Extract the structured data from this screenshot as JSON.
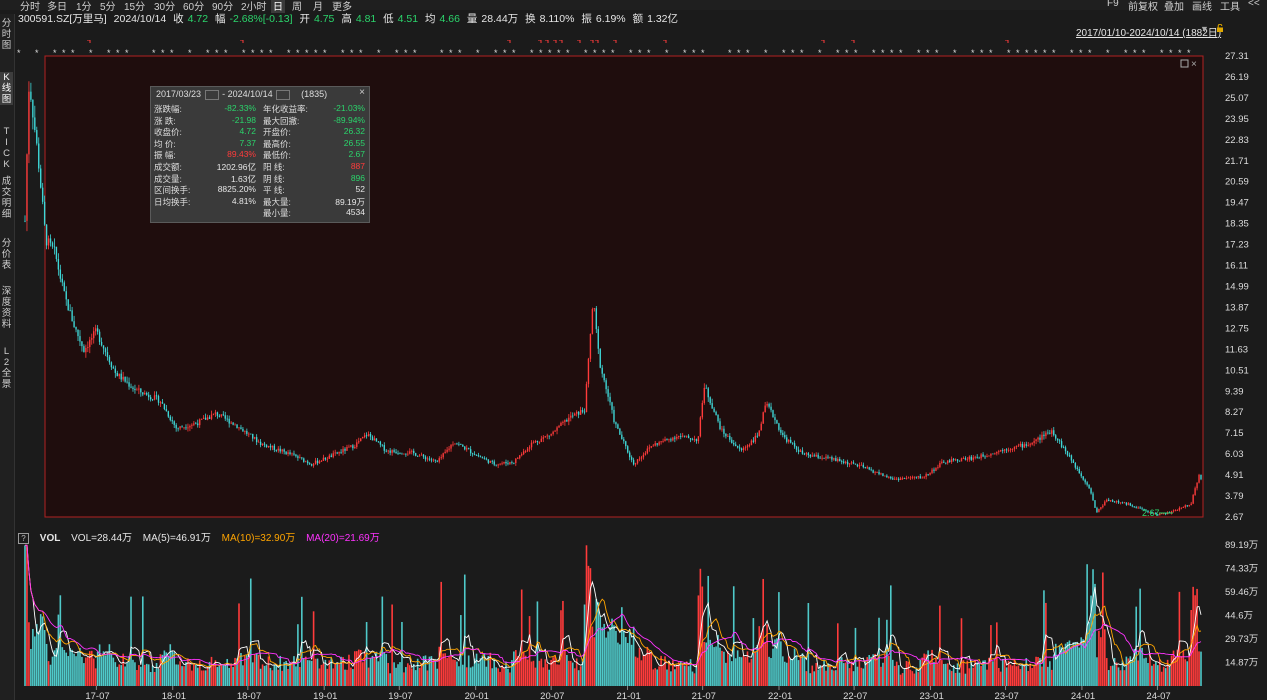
{
  "periods": [
    "分时",
    "多日",
    "1分",
    "5分",
    "15分",
    "30分",
    "60分",
    "90分",
    "2小时",
    "日",
    "周",
    "月",
    "更多"
  ],
  "active_period": "日",
  "tools": [
    "F9",
    "前复权",
    "叠加",
    "画线",
    "工具",
    "<<"
  ],
  "quote": {
    "code": "300591.SZ[万里马]",
    "date": "2024/10/14",
    "close_label": "收",
    "close": "4.72",
    "change_label": "幅",
    "change": "-2.68%[-0.13]",
    "open_label": "开",
    "open": "4.75",
    "high_label": "高",
    "high": "4.81",
    "low_label": "低",
    "low": "4.51",
    "avg_label": "均",
    "avg": "4.66",
    "vol_label": "量",
    "vol": "28.44万",
    "turnover_label": "换",
    "turnover": "8.110%",
    "amp_label": "振",
    "amp": "6.19%",
    "amount_label": "额",
    "amount": "1.32亿"
  },
  "sidebar": [
    {
      "label": "分时图",
      "active": false
    },
    {
      "label": "K线图",
      "active": true
    },
    {
      "label": "TICK",
      "active": false
    },
    {
      "label": "成交明细",
      "active": false
    },
    {
      "label": "分价表",
      "active": false
    },
    {
      "label": "深度资料",
      "active": false
    },
    {
      "label": "L2全景",
      "active": false
    }
  ],
  "date_range": "2017/01/10-2024/10/14 (1882日)",
  "stats": {
    "header_start": "2017/03/23",
    "header_end": "2024/10/14",
    "header_count": "(1835)",
    "left": [
      {
        "k": "涨跌幅:",
        "v": "-82.33%",
        "c": "g"
      },
      {
        "k": "涨  跌:",
        "v": "-21.98",
        "c": "g"
      },
      {
        "k": "收盘价:",
        "v": "4.72",
        "c": "g"
      },
      {
        "k": "均  价:",
        "v": "7.37",
        "c": "g"
      },
      {
        "k": "振  幅:",
        "v": "89.43%",
        "c": "r"
      },
      {
        "k": "成交额:",
        "v": "1202.96亿",
        "c": "w"
      },
      {
        "k": "成交量:",
        "v": "1.63亿",
        "c": "w"
      },
      {
        "k": "区间换手:",
        "v": "8825.20%",
        "c": "w"
      },
      {
        "k": "日均换手:",
        "v": "4.81%",
        "c": "w"
      }
    ],
    "right": [
      {
        "k": "年化收益率:",
        "v": "-21.03%",
        "c": "g"
      },
      {
        "k": "最大回撤:",
        "v": "-89.94%",
        "c": "g"
      },
      {
        "k": "开盘价:",
        "v": "26.32",
        "c": "g"
      },
      {
        "k": "最高价:",
        "v": "26.55",
        "c": "g"
      },
      {
        "k": "最低价:",
        "v": "2.67",
        "c": "g"
      },
      {
        "k": "阳  线:",
        "v": "887",
        "c": "r"
      },
      {
        "k": "阴  线:",
        "v": "896",
        "c": "g"
      },
      {
        "k": "平  线:",
        "v": "52",
        "c": "w"
      },
      {
        "k": "最大量:",
        "v": "89.19万",
        "c": "w"
      },
      {
        "k": "最小量:",
        "v": "4534",
        "c": "w"
      }
    ]
  },
  "price_axis": [
    "27.31",
    "26.19",
    "25.07",
    "23.95",
    "22.83",
    "21.71",
    "20.59",
    "19.47",
    "18.35",
    "17.23",
    "16.11",
    "14.99",
    "13.87",
    "12.75",
    "11.63",
    "10.51",
    "9.39",
    "8.27",
    "7.15",
    "6.03",
    "4.91",
    "3.79",
    "2.67"
  ],
  "vol_axis": [
    "89.19万",
    "74.33万",
    "59.46万",
    "44.6万",
    "29.73万",
    "14.87万"
  ],
  "x_ticks": [
    "17-07",
    "18-01",
    "18-07",
    "19-01",
    "19-07",
    "20-01",
    "20-07",
    "21-01",
    "21-07",
    "22-01",
    "22-07",
    "23-01",
    "23-07",
    "24-01",
    "24-07"
  ],
  "min_label": "2.67",
  "vol_legend": {
    "name": "VOL",
    "vol": "VOL=28.44万",
    "ma5": "MA(5)=46.91万",
    "ma10": "MA(10)=32.90万",
    "ma20": "MA(20)=21.69万"
  },
  "colors": {
    "up": "#ff3b3b",
    "down": "#3ed6d6",
    "frame": "#b22222",
    "ma5": "#ffffff",
    "ma10": "#ffa500",
    "ma20": "#ff33ff"
  },
  "chart_data": {
    "type": "candlestick",
    "price_ylim": [
      2.67,
      27.31
    ],
    "volume_ylim_wan": [
      0,
      89.19
    ],
    "price_path": [
      [
        "2017-01-10",
        18.5
      ],
      [
        "2017-01-20",
        26.0
      ],
      [
        "2017-02-10",
        22.0
      ],
      [
        "2017-03-01",
        17.5
      ],
      [
        "2017-03-23",
        16.8
      ],
      [
        "2017-04-15",
        14.5
      ],
      [
        "2017-05-10",
        12.8
      ],
      [
        "2017-06-01",
        11.6
      ],
      [
        "2017-07-01",
        12.6
      ],
      [
        "2017-08-15",
        10.4
      ],
      [
        "2017-10-01",
        9.5
      ],
      [
        "2017-12-01",
        8.9
      ],
      [
        "2018-01-10",
        7.4
      ],
      [
        "2018-03-01",
        7.7
      ],
      [
        "2018-04-15",
        8.2
      ],
      [
        "2018-06-01",
        7.6
      ],
      [
        "2018-08-01",
        6.6
      ],
      [
        "2018-10-15",
        6.0
      ],
      [
        "2018-12-01",
        5.5
      ],
      [
        "2019-01-15",
        5.9
      ],
      [
        "2019-03-15",
        6.5
      ],
      [
        "2019-04-15",
        7.1
      ],
      [
        "2019-06-01",
        6.2
      ],
      [
        "2019-08-01",
        6.1
      ],
      [
        "2019-10-01",
        5.6
      ],
      [
        "2019-11-10",
        6.7
      ],
      [
        "2020-01-01",
        6.0
      ],
      [
        "2020-02-15",
        5.5
      ],
      [
        "2020-04-01",
        5.6
      ],
      [
        "2020-05-15",
        6.6
      ],
      [
        "2020-07-01",
        7.1
      ],
      [
        "2020-08-15",
        8.0
      ],
      [
        "2020-09-20",
        8.4
      ],
      [
        "2020-10-10",
        14.3
      ],
      [
        "2020-10-25",
        11.0
      ],
      [
        "2020-12-01",
        7.7
      ],
      [
        "2021-01-15",
        5.5
      ],
      [
        "2021-03-01",
        6.5
      ],
      [
        "2021-05-01",
        7.0
      ],
      [
        "2021-06-20",
        6.8
      ],
      [
        "2021-07-05",
        9.7
      ],
      [
        "2021-08-15",
        7.3
      ],
      [
        "2021-10-01",
        6.2
      ],
      [
        "2021-11-10",
        7.0
      ],
      [
        "2021-12-01",
        8.7
      ],
      [
        "2021-12-20",
        8.0
      ],
      [
        "2022-01-10",
        7.0
      ],
      [
        "2022-03-01",
        6.0
      ],
      [
        "2022-05-01",
        5.8
      ],
      [
        "2022-07-15",
        5.4
      ],
      [
        "2022-10-01",
        4.7
      ],
      [
        "2022-12-15",
        4.8
      ],
      [
        "2023-02-01",
        5.6
      ],
      [
        "2023-05-01",
        5.9
      ],
      [
        "2023-07-01",
        6.3
      ],
      [
        "2023-09-01",
        6.6
      ],
      [
        "2023-10-20",
        7.3
      ],
      [
        "2023-12-01",
        5.9
      ],
      [
        "2024-01-20",
        4.2
      ],
      [
        "2024-02-05",
        2.9
      ],
      [
        "2024-03-01",
        3.6
      ],
      [
        "2024-05-01",
        3.3
      ],
      [
        "2024-06-01",
        3.0
      ],
      [
        "2024-07-01",
        2.8
      ],
      [
        "2024-08-01",
        2.9
      ],
      [
        "2024-09-20",
        3.4
      ],
      [
        "2024-10-10",
        5.0
      ],
      [
        "2024-10-14",
        4.72
      ]
    ]
  }
}
